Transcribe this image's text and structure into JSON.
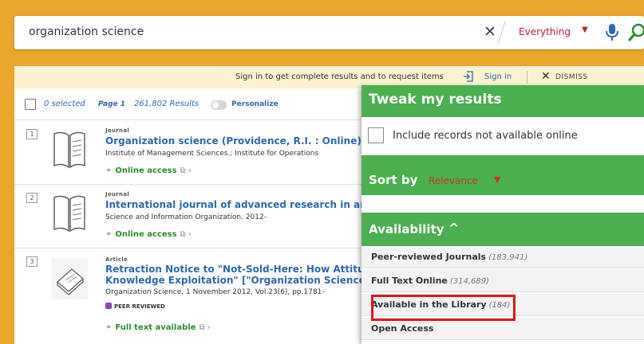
{
  "search": {
    "query": "organization science",
    "scope": "Everything"
  },
  "signin_bar": {
    "message": "Sign in to get complete results and to request items",
    "signin_label": "Sign in",
    "dismiss_label": "DISMISS"
  },
  "results_bar": {
    "selected": "0 selected",
    "page": "Page 1",
    "count": "261,802 Results",
    "personalize": "Personalize"
  },
  "results": [
    {
      "num": "1",
      "type": "Journal",
      "title": "Organization science (Providence, R.I. : Online)",
      "subtitle": "Institute of Management Sciences.; Institute for Operations",
      "link": "Online access"
    },
    {
      "num": "2",
      "type": "Journal",
      "title": "International journal of advanced research in arti",
      "subtitle": "Science and Information Organization. 2012-",
      "link": "Online access"
    },
    {
      "num": "3",
      "type": "Article",
      "title_line1": "Retraction Notice to \"Not-Sold-Here: How Attitud",
      "title_line2": "Knowledge Exploitation\" [\"Organization Science\"",
      "subtitle": "Organization Science, 1 November 2012, Vol.23(6), pp.1781-",
      "badge": "PEER REVIEWED",
      "link": "Full text available"
    }
  ],
  "panel": {
    "title": "Tweak my results",
    "include_label": "Include records not available online",
    "sort_label": "Sort by",
    "sort_value": "Relevance",
    "availability_label": "Availability",
    "facets": [
      {
        "label": "Peer-reviewed Journals",
        "count": "(183,941)"
      },
      {
        "label": "Full Text Online",
        "count": "(314,689)"
      },
      {
        "label": "Available in the Library",
        "count": "(184)"
      },
      {
        "label": "Open Access",
        "count": ""
      }
    ]
  },
  "colors": {
    "header_bg": "#e9a72d",
    "panel_green": "#4caf50",
    "link_blue": "#2e67b2",
    "access_green": "#2b8a2b",
    "highlight_red": "#e0161c"
  }
}
